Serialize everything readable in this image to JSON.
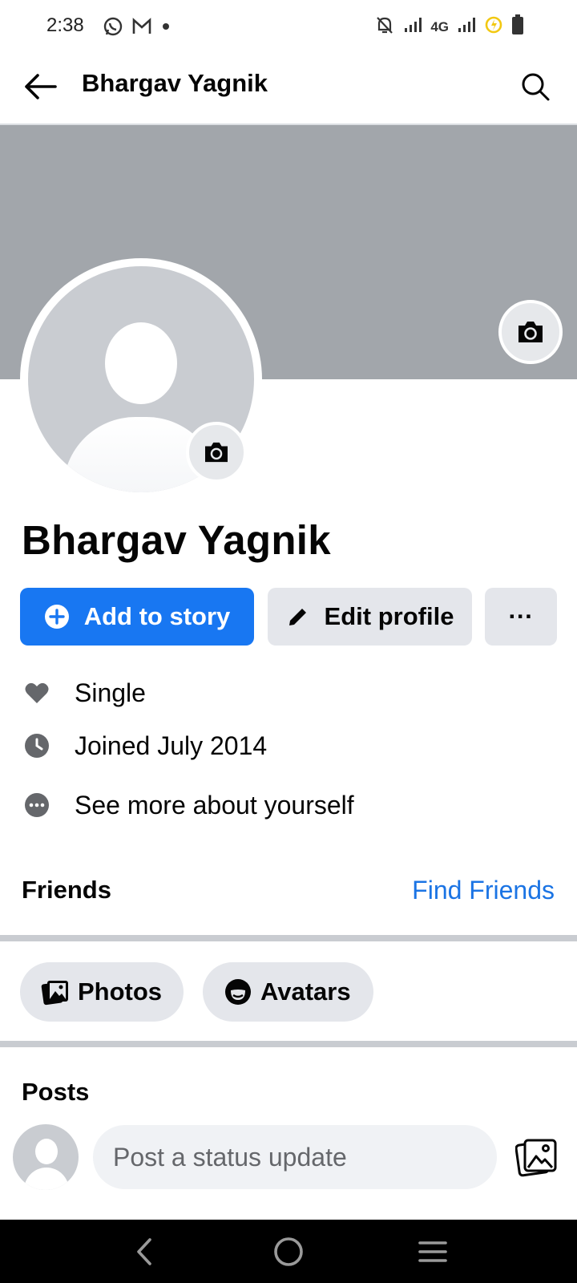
{
  "status_bar": {
    "time": "2:38",
    "network": "4G"
  },
  "app_bar": {
    "title": "Bhargav Yagnik"
  },
  "profile": {
    "name": "Bhargav Yagnik"
  },
  "actions": {
    "add_story": "Add to story",
    "edit_profile": "Edit profile",
    "more": "···"
  },
  "intro": {
    "items": [
      {
        "icon": "heart-icon",
        "text": "Single"
      },
      {
        "icon": "clock-icon",
        "text": "Joined July 2014"
      },
      {
        "icon": "more-circle-icon",
        "text": "See more about yourself"
      }
    ]
  },
  "friends": {
    "title": "Friends",
    "find_link": "Find Friends"
  },
  "chips": {
    "photos": "Photos",
    "avatars": "Avatars"
  },
  "posts": {
    "title": "Posts",
    "composer_placeholder": "Post a status update"
  },
  "colors": {
    "accent": "#1877f2",
    "cover": "#a2a6ab",
    "link": "#1b74e4"
  }
}
